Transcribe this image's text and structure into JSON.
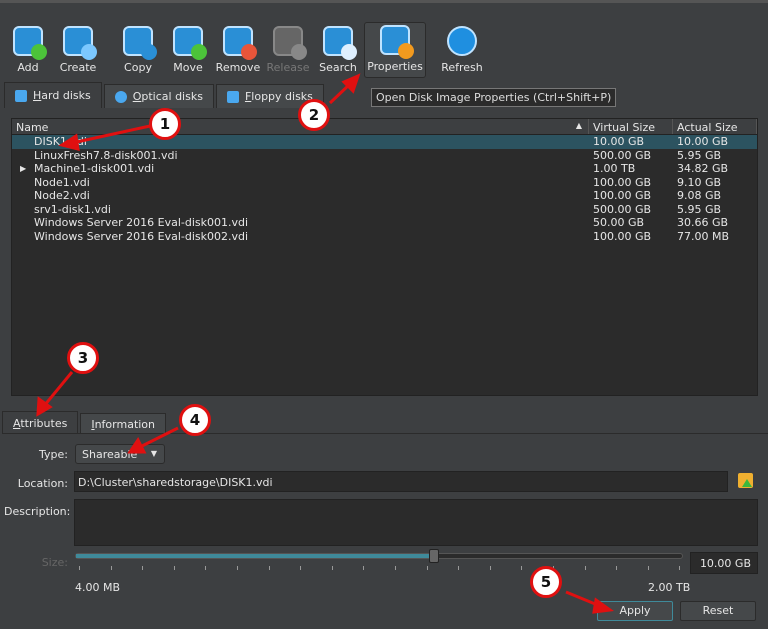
{
  "toolbar": {
    "items": [
      {
        "label": "Add",
        "icon": "add-disk-icon",
        "enabled": true
      },
      {
        "label": "Create",
        "icon": "create-disk-icon",
        "enabled": true
      },
      {
        "label": "Copy",
        "icon": "copy-disk-icon",
        "enabled": true
      },
      {
        "label": "Move",
        "icon": "move-disk-icon",
        "enabled": true
      },
      {
        "label": "Remove",
        "icon": "remove-disk-icon",
        "enabled": true
      },
      {
        "label": "Release",
        "icon": "release-disk-icon",
        "enabled": false
      },
      {
        "label": "Search",
        "icon": "search-disk-icon",
        "enabled": true
      },
      {
        "label": "Properties",
        "icon": "properties-icon",
        "enabled": true
      },
      {
        "label": "Refresh",
        "icon": "refresh-icon",
        "enabled": true
      }
    ]
  },
  "tooltip": "Open Disk Image Properties (Ctrl+Shift+P)",
  "media_tabs": [
    {
      "label": "Hard disks",
      "u": "H",
      "rest": "ard disks"
    },
    {
      "label": "Optical disks",
      "u": "O",
      "rest": "ptical disks"
    },
    {
      "label": "Floppy disks",
      "u": "F",
      "rest": "loppy disks"
    }
  ],
  "table": {
    "columns": [
      "Name",
      "Virtual Size",
      "Actual Size"
    ],
    "rows": [
      {
        "name": "DISK1.vdi",
        "virtual": "10.00 GB",
        "actual": "10.00 GB",
        "selected": true
      },
      {
        "name": "LinuxFresh7.8-disk001.vdi",
        "virtual": "500.00 GB",
        "actual": "5.95 GB"
      },
      {
        "name": "Machine1-disk001.vdi",
        "virtual": "1.00 TB",
        "actual": "34.82 GB",
        "expandable": true
      },
      {
        "name": "Node1.vdi",
        "virtual": "100.00 GB",
        "actual": "9.10 GB"
      },
      {
        "name": "Node2.vdi",
        "virtual": "100.00 GB",
        "actual": "9.08 GB"
      },
      {
        "name": "srv1-disk1.vdi",
        "virtual": "500.00 GB",
        "actual": "5.95 GB"
      },
      {
        "name": "Windows Server 2016 Eval-disk001.vdi",
        "virtual": "50.00 GB",
        "actual": "30.66 GB"
      },
      {
        "name": "Windows Server 2016 Eval-disk002.vdi",
        "virtual": "100.00 GB",
        "actual": "77.00 MB"
      }
    ]
  },
  "detail_tabs": [
    {
      "u": "A",
      "rest": "ttributes"
    },
    {
      "u": "I",
      "rest": "nformation"
    }
  ],
  "attributes": {
    "type_label": "Type:",
    "type_value": "Shareable",
    "location_label": "Location:",
    "location_value": "D:\\Cluster\\sharedstorage\\DISK1.vdi",
    "description_label": "Description:",
    "description_value": "",
    "size_label": "Size:",
    "size_value": "10.00 GB",
    "size_min": "4.00 MB",
    "size_max": "2.00 TB",
    "size_fraction": 0.59,
    "apply": "Apply",
    "reset": "Reset"
  },
  "callouts": [
    "1",
    "2",
    "3",
    "4",
    "5"
  ],
  "colors": {
    "selection": "#2c5360",
    "annotation": "#e01010"
  }
}
